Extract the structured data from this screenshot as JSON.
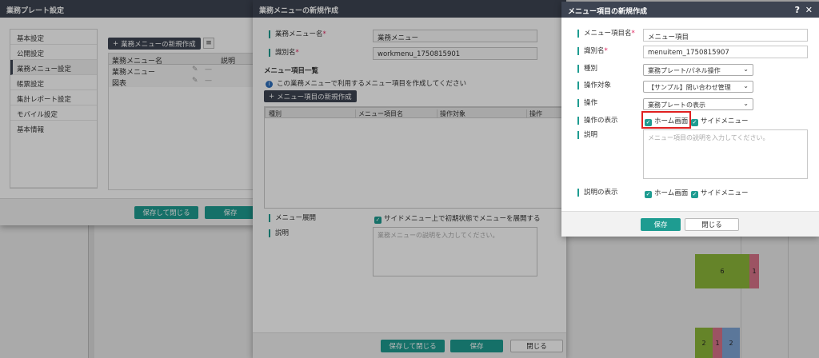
{
  "bg_chart": {
    "segments": [
      {
        "label": "6",
        "color": "#8db83a"
      },
      {
        "label": "1",
        "color": "#d9738a"
      },
      {
        "label": "2",
        "color": "#8db83a"
      },
      {
        "label": "1",
        "color": "#d9738a"
      },
      {
        "label": "2",
        "color": "#7fa6d6"
      }
    ]
  },
  "win1": {
    "title": "業務プレート設定",
    "sidebar": [
      "基本設定",
      "公開設定",
      "業務メニュー設定",
      "帳票設定",
      "集計レポート設定",
      "モバイル設定",
      "基本情報"
    ],
    "add_button": "業務メニューの新規作成",
    "columns": [
      "業務メニュー名",
      "説明"
    ],
    "rows": [
      "業務メニュー",
      "図表"
    ],
    "save_close": "保存して閉じる",
    "save": "保存"
  },
  "win2": {
    "title": "業務メニューの新規作成",
    "name_label": "業務メニュー名",
    "name_value": "業務メニュー",
    "id_label": "識別名",
    "id_value": "workmenu_1750815901",
    "section": "メニュー項目一覧",
    "info": "この業務メニューで利用するメニュー項目を作成してください",
    "add_item": "メニュー項目の新規作成",
    "grid_cols": [
      "種別",
      "メニュー項目名",
      "操作対象",
      "操作"
    ],
    "expand_label": "メニュー展開",
    "expand_option": "サイドメニュー上で初期状態でメニューを展開する",
    "desc_label": "説明",
    "desc_placeholder": "業務メニューの説明を入力してください。",
    "save_close": "保存して閉じる",
    "save": "保存",
    "close": "閉じる"
  },
  "win3": {
    "title": "メニュー項目の新規作成",
    "help": "?",
    "close_x": "✕",
    "name_label": "メニュー項目名",
    "name_value": "メニュー項目",
    "id_label": "識別名",
    "id_value": "menuitem_1750815907",
    "type_label": "種別",
    "type_value": "業務プレート/パネル操作",
    "target_label": "操作対象",
    "target_value": "【サンプル】問い合わせ管理",
    "op_label": "操作",
    "op_value": "業務プレートの表示",
    "display_label": "操作の表示",
    "home": "ホーム画面",
    "side": "サイドメニュー",
    "desc_label": "説明",
    "desc_placeholder": "メニュー項目の説明を入力してください。",
    "desc_display_label": "説明の表示",
    "save": "保存",
    "close": "閉じる"
  }
}
